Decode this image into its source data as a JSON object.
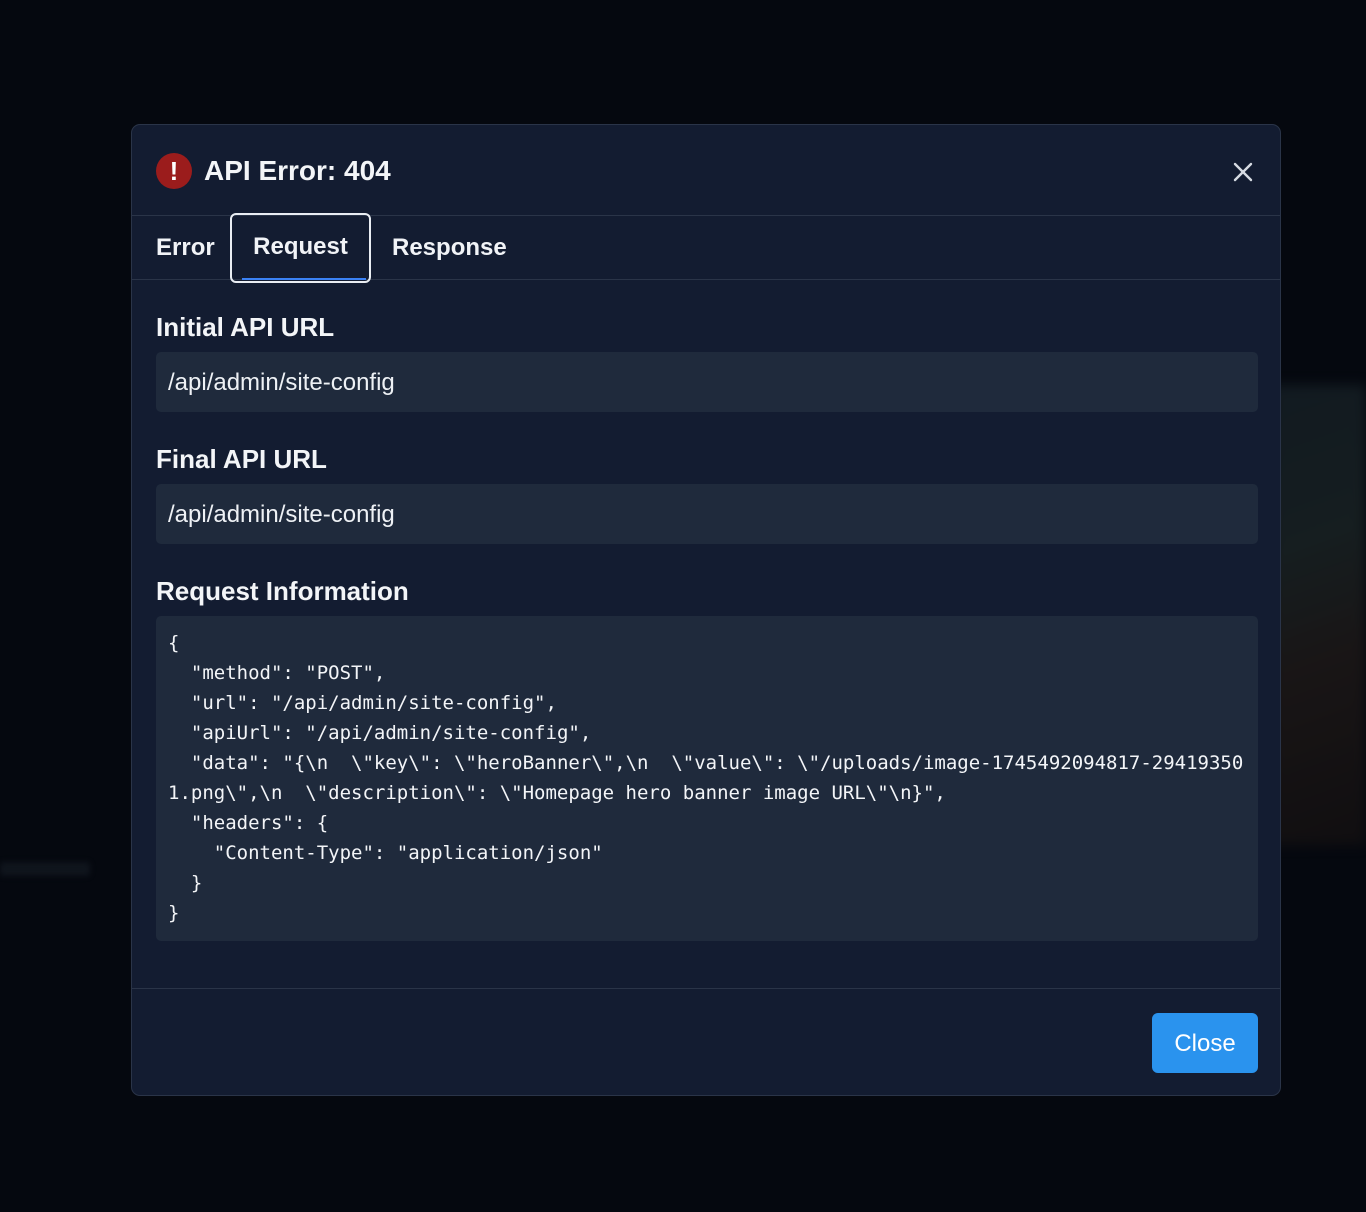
{
  "modal": {
    "title": "API Error: 404",
    "error_icon_glyph": "!",
    "error_icon": "exclamation-circle-icon",
    "close_icon": "close-icon",
    "colors": {
      "error": "#9b1c1c",
      "accent": "#2a93ee",
      "tab_underline": "#3b82f6",
      "surface": "#131c31",
      "field": "#1f2a3c"
    }
  },
  "tabs": [
    {
      "label": "Error",
      "active": false
    },
    {
      "label": "Request",
      "active": true
    },
    {
      "label": "Response",
      "active": false
    }
  ],
  "request": {
    "initial_url_label": "Initial API URL",
    "initial_url": "/api/admin/site-config",
    "final_url_label": "Final API URL",
    "final_url": "/api/admin/site-config",
    "info_label": "Request Information",
    "info_json": "{\n  \"method\": \"POST\",\n  \"url\": \"/api/admin/site-config\",\n  \"apiUrl\": \"/api/admin/site-config\",\n  \"data\": \"{\\n  \\\"key\\\": \\\"heroBanner\\\",\\n  \\\"value\\\": \\\"/uploads/image-1745492094817-294193501.png\\\",\\n  \\\"description\\\": \\\"Homepage hero banner image URL\\\"\\n}\",\n  \"headers\": {\n    \"Content-Type\": \"application/json\"\n  }\n}"
  },
  "footer": {
    "close_label": "Close"
  }
}
